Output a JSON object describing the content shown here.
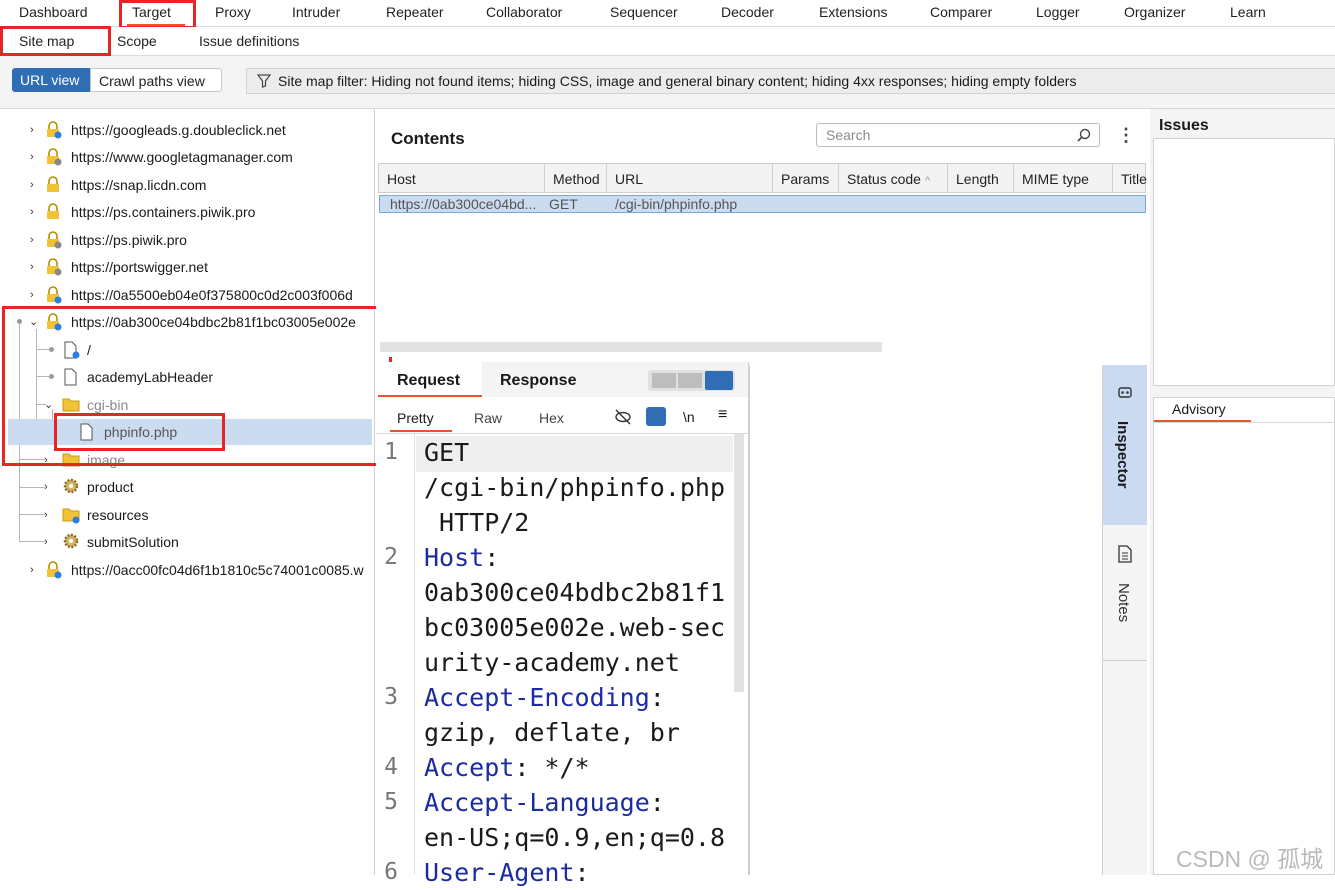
{
  "top_tabs": [
    "Dashboard",
    "Target",
    "Proxy",
    "Intruder",
    "Repeater",
    "Collaborator",
    "Sequencer",
    "Decoder",
    "Extensions",
    "Comparer",
    "Logger",
    "Organizer",
    "Learn"
  ],
  "sub_tabs": [
    "Site map",
    "Scope",
    "Issue definitions"
  ],
  "view_toggle": {
    "url_view": "URL view",
    "crawl_paths_view": "Crawl paths view"
  },
  "filter_text": "Site map filter: Hiding not found items;  hiding CSS, image and general binary content;  hiding 4xx responses;  hiding empty folders",
  "tree": {
    "hosts_top": [
      "https://googleads.g.doubleclick.net",
      "https://www.googletagmanager.com",
      "https://snap.licdn.com",
      "https://ps.containers.piwik.pro",
      "https://ps.piwik.pro",
      "https://portswigger.net",
      "https://0a5500eb04e0f375800c0d2c003f006d"
    ],
    "expanded_host": "https://0ab300ce04bdbc2b81f1bc03005e002e",
    "children": {
      "root": "/",
      "header": "academyLabHeader",
      "cgi_bin": "cgi-bin",
      "phpinfo": "phpinfo.php",
      "image": "image",
      "product": "product",
      "resources": "resources",
      "submit": "submitSolution"
    },
    "host_bottom": "https://0acc00fc04d6f1b1810c5c74001c0085.w"
  },
  "contents": {
    "title": "Contents",
    "search_placeholder": "Search",
    "columns": [
      "Host",
      "Method",
      "URL",
      "Params",
      "Status code",
      "Length",
      "MIME type",
      "Title"
    ],
    "row": {
      "host": "https://0ab300ce04bd...",
      "method": "GET",
      "url": "/cgi-bin/phpinfo.php"
    }
  },
  "request_panel": {
    "tabs": [
      "Request",
      "Response"
    ],
    "sub_tabs": [
      "Pretty",
      "Raw",
      "Hex"
    ],
    "newline_label": "\\n",
    "lines": [
      {
        "n": "1",
        "key": "",
        "val": "GET\n/cgi-bin/phpinfo.php\n HTTP/2"
      },
      {
        "n": "2",
        "key": "Host",
        "val": "\n0ab300ce04bdbc2b81f1\nbc03005e002e.web-sec\nurity-academy.net"
      },
      {
        "n": "3",
        "key": "Accept-Encoding",
        "val": "\ngzip, deflate, br"
      },
      {
        "n": "4",
        "key": "Accept",
        "val": " */*"
      },
      {
        "n": "5",
        "key": "Accept-Language",
        "val": "\nen-US;q=0.9,en;q=0.8"
      },
      {
        "n": "6",
        "key": "User-Agent",
        "val": ""
      }
    ]
  },
  "side_tabs": {
    "inspector": "Inspector",
    "notes": "Notes"
  },
  "issues": {
    "title": "Issues",
    "advisory": "Advisory"
  },
  "watermark": "CSDN @ 孤城"
}
